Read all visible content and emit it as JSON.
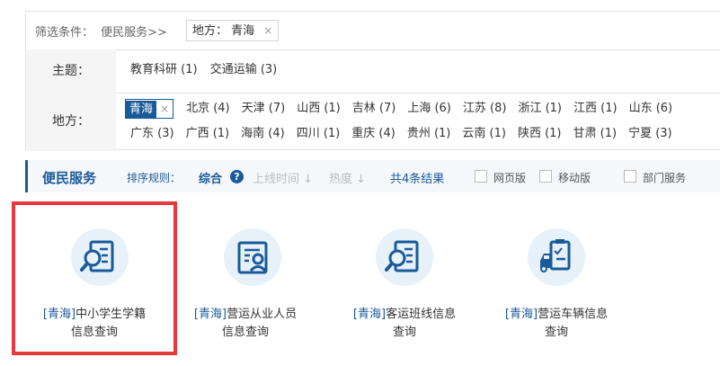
{
  "filter": {
    "label": "筛选条件：",
    "breadcrumb": "便民服务>>",
    "tag_key": "地方：",
    "tag_value": "青海",
    "close_glyph": "×"
  },
  "topic": {
    "label": "主题：",
    "items": [
      "教育科研 (1)",
      "交通运输 (3)"
    ]
  },
  "region": {
    "label": "地方：",
    "selected": "青海",
    "line1": [
      "北京 (4)",
      "天津 (7)",
      "山西 (1)",
      "吉林 (7)",
      "上海 (6)",
      "江苏 (8)",
      "浙江 (1)",
      "江西 (1)",
      "山东 (6)"
    ],
    "line2": [
      "广东 (3)",
      "广西 (1)",
      "海南 (4)",
      "四川 (1)",
      "重庆 (4)",
      "贵州 (1)",
      "云南 (1)",
      "陕西 (1)",
      "甘肃 (1)",
      "宁夏 (3)"
    ]
  },
  "service_bar": {
    "title": "便民服务",
    "sort_label": "排序规则：",
    "sort_combo": "综合",
    "help_glyph": "?",
    "sort_time": "上线时间 ↓",
    "sort_hot": "热度 ↓",
    "total": "共4条结果",
    "checkboxes": [
      "网页版",
      "移动版",
      "部门服务"
    ]
  },
  "cards": [
    {
      "prov": "[青海]",
      "line1": "中小学生学籍",
      "line2": "信息查询",
      "icon": "document-search-icon"
    },
    {
      "prov": "[青海]",
      "line1": "营运从业人员",
      "line2": "信息查询",
      "icon": "person-card-icon"
    },
    {
      "prov": "[青海]",
      "line1": "客运班线信息",
      "line2": "查询",
      "icon": "document-search-icon"
    },
    {
      "prov": "[青海]",
      "line1": "营运车辆信息",
      "line2": "查询",
      "icon": "vehicle-checklist-icon"
    }
  ],
  "colors": {
    "accent": "#1a5a98",
    "highlight": "#e8383a",
    "icon_bg": "#e6f1fa"
  }
}
